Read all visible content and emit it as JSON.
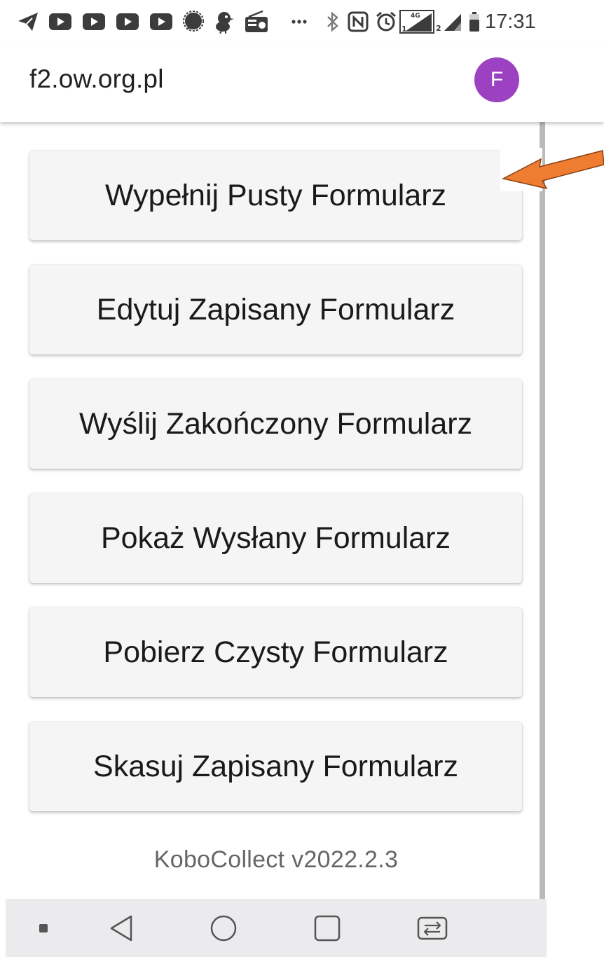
{
  "status_bar": {
    "time": "17:31",
    "icons": [
      "telegram-icon",
      "youtube-icon",
      "youtube-icon",
      "youtube-icon",
      "youtube-icon",
      "signal-icon",
      "bird-icon",
      "radio-icon",
      "more-icon",
      "bluetooth-icon",
      "nfc-icon",
      "alarm-icon",
      "signal-4g-sim1-icon",
      "signal-sim2-icon",
      "battery-icon"
    ],
    "network_label": "4G",
    "sim1": "1",
    "sim2": "2"
  },
  "app_bar": {
    "title": "f2.ow.org.pl",
    "avatar_letter": "F",
    "avatar_color": "#9b41c2"
  },
  "menu": {
    "buttons": [
      {
        "label": "Wypełnij Pusty Formularz"
      },
      {
        "label": "Edytuj Zapisany Formularz"
      },
      {
        "label": "Wyślij Zakończony Formularz"
      },
      {
        "label": "Pokaż Wysłany Formularz"
      },
      {
        "label": "Pobierz Czysty Formularz"
      },
      {
        "label": "Skasuj Zapisany Formularz"
      }
    ]
  },
  "footer": {
    "version": "KoboCollect v2022.2.3"
  },
  "nav_bar": {
    "icons": [
      "menu-dot-icon",
      "back-icon",
      "home-icon",
      "recents-icon",
      "switch-app-icon"
    ]
  },
  "annotation": {
    "arrow_color": "#ee7d31"
  }
}
